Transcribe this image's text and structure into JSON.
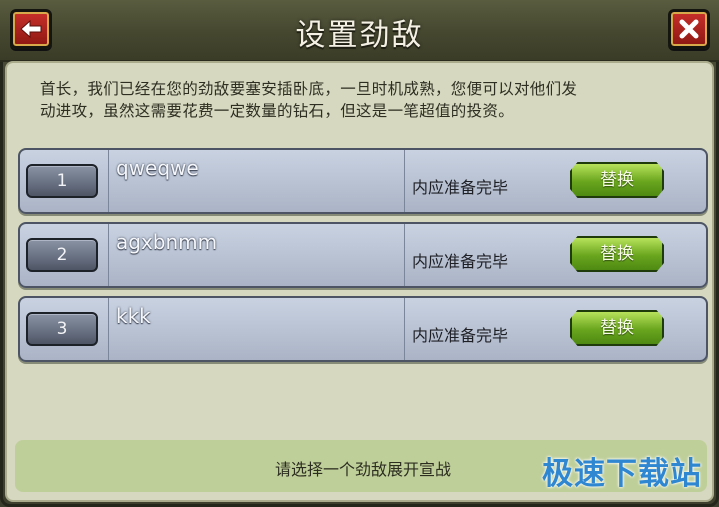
{
  "header": {
    "title": "设置劲敌",
    "back_icon": "back-arrow-icon",
    "close_icon": "close-x-icon"
  },
  "intro": {
    "line1": "首长，我们已经在您的劲敌要塞安插卧底，一旦时机成熟，您便可以对他们发",
    "line2": "动进攻，虽然这需要花费一定数量的钻石，但这是一笔超值的投资。"
  },
  "rivals": [
    {
      "number": "1",
      "name": "qweqwe",
      "status": "内应准备完毕",
      "button": "替换"
    },
    {
      "number": "2",
      "name": "agxbnmm",
      "status": "内应准备完毕",
      "button": "替换"
    },
    {
      "number": "3",
      "name": "kkk",
      "status": "内应准备完毕",
      "button": "替换"
    }
  ],
  "footer": {
    "prompt": "请选择一个劲敌展开宣战",
    "watermark": "极速下载站"
  },
  "colors": {
    "accent_green": "#6aa51e",
    "close_red": "#c9302b",
    "watermark_blue": "#2f86d1"
  }
}
